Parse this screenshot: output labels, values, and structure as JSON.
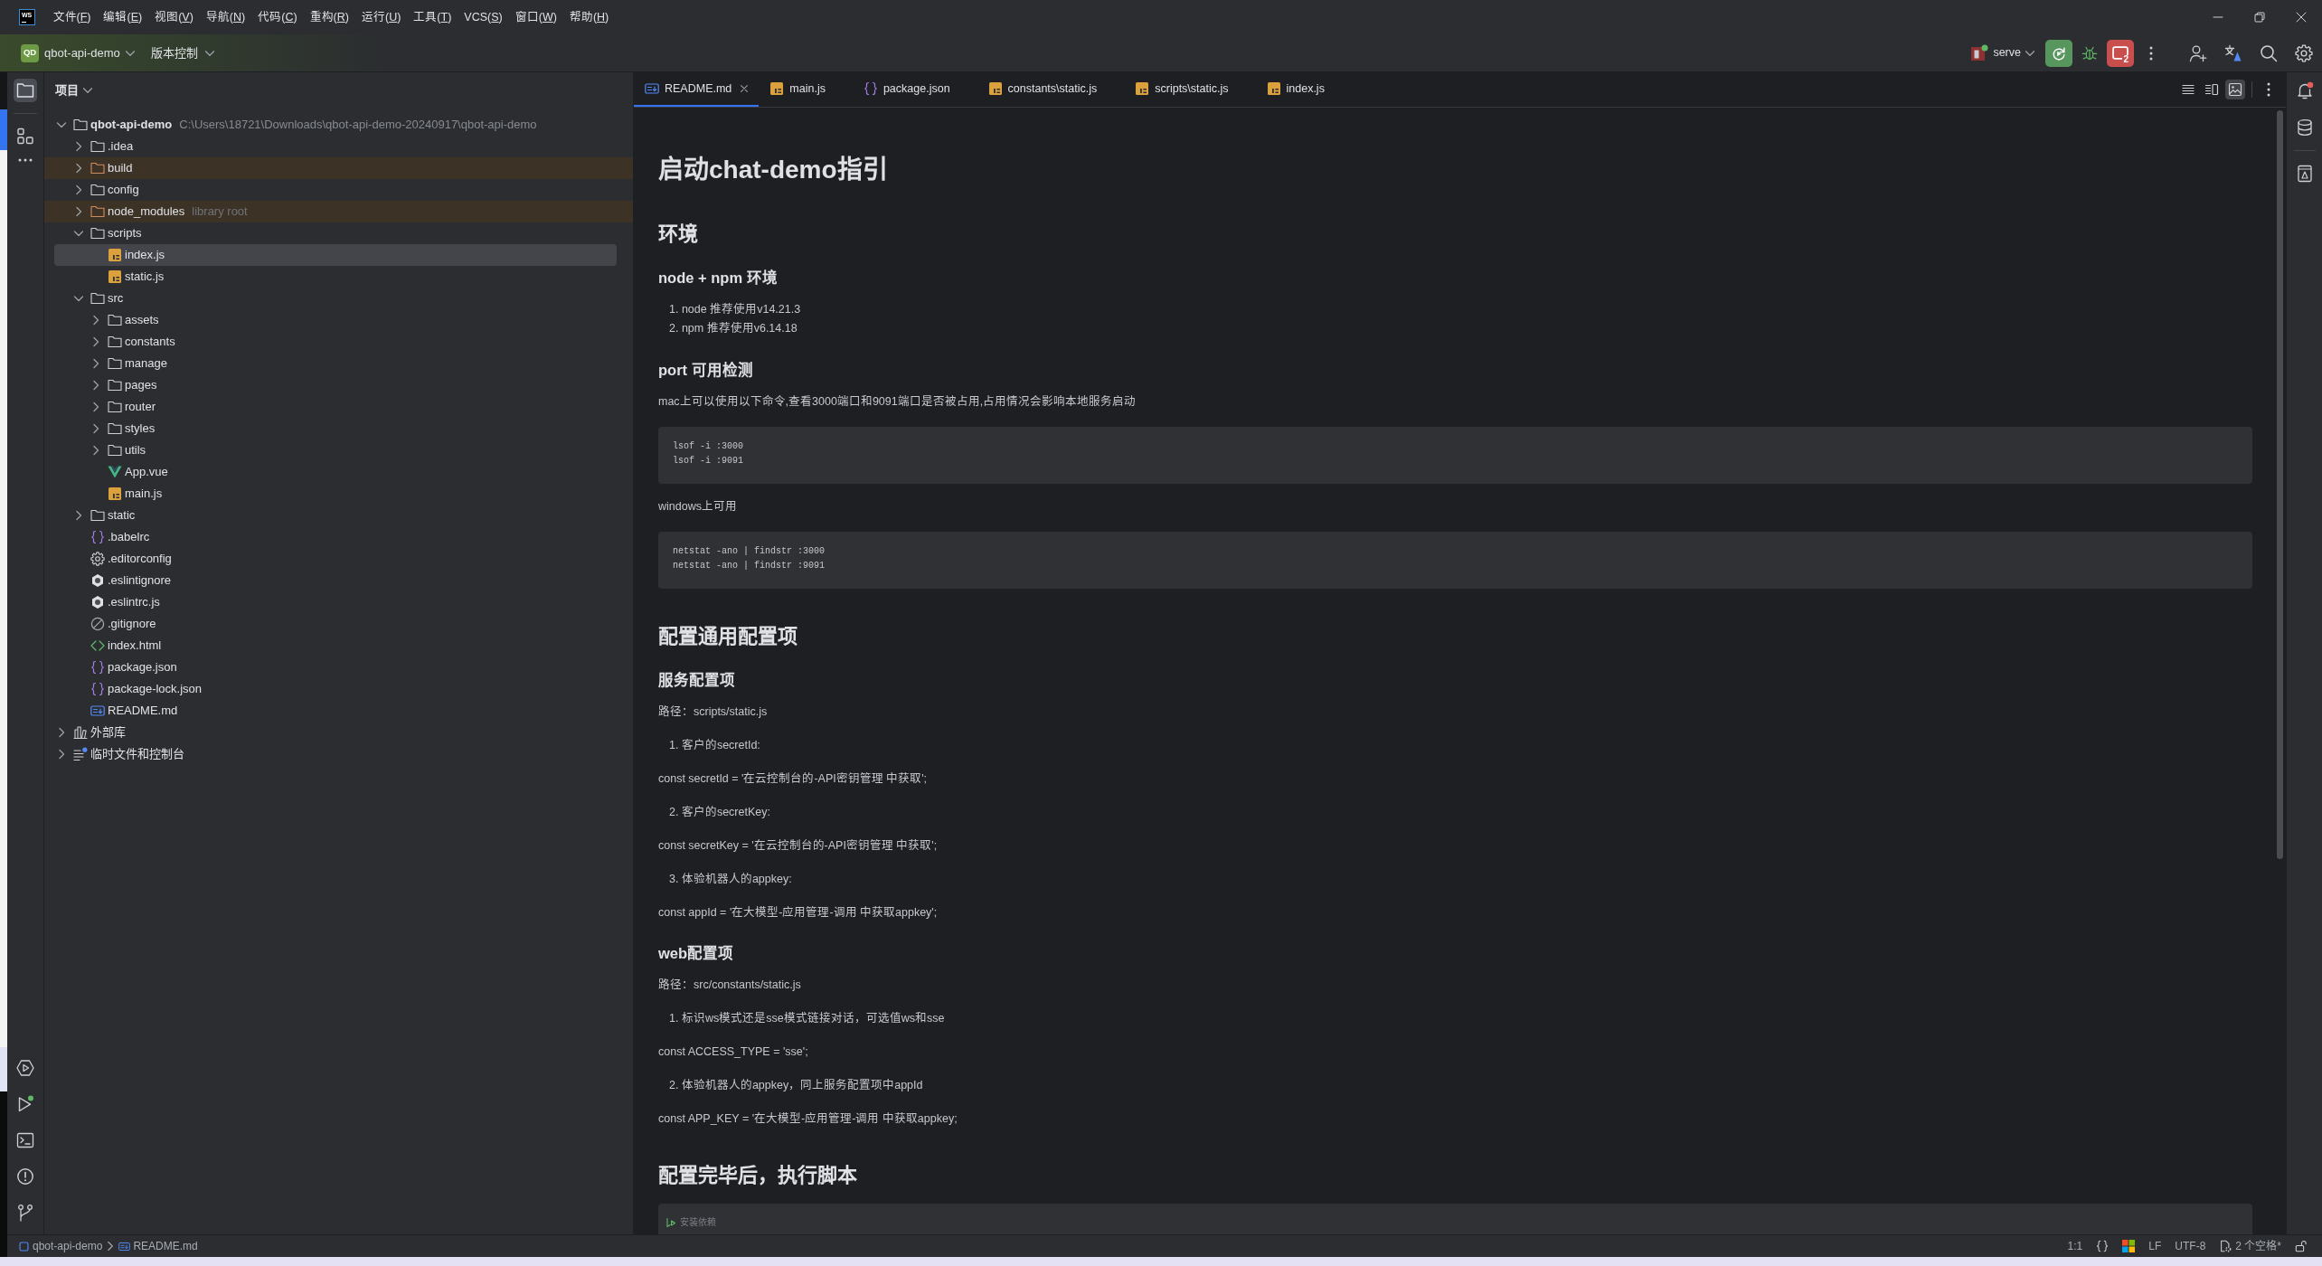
{
  "window": {
    "logo": "WS",
    "menu": [
      "文件(F)",
      "编辑(E)",
      "视图(V)",
      "导航(N)",
      "代码(C)",
      "重构(R)",
      "运行(U)",
      "工具(T)",
      "VCS(S)",
      "窗口(W)",
      "帮助(H)"
    ]
  },
  "toolbar": {
    "project_badge": "QD",
    "project": "qbot-api-demo",
    "vcs": "版本控制",
    "run_config": "serve",
    "stop_count": "2"
  },
  "tool_strip": [
    {
      "kind": "project",
      "selected": true
    },
    {
      "kind": "structure",
      "selected": false
    },
    {
      "kind": "more",
      "selected": false
    }
  ],
  "project_panel": {
    "title": "项目",
    "tree": [
      {
        "name": "qbot-api-demo",
        "path": "C:\\Users\\18721\\Downloads\\qbot-api-demo-20240917\\qbot-api-demo",
        "kind": "folder",
        "expanded": true,
        "excluded": false,
        "selected": false,
        "children": [
          {
            "name": ".idea",
            "kind": "folder",
            "expanded": false,
            "excluded": false,
            "selected": false
          },
          {
            "name": "build",
            "kind": "folder",
            "expanded": false,
            "excluded": true,
            "selected": false
          },
          {
            "name": "config",
            "kind": "folder",
            "expanded": false,
            "excluded": false,
            "selected": false
          },
          {
            "name": "node_modules",
            "note": "library root",
            "kind": "folder",
            "expanded": false,
            "excluded": true,
            "selected": false
          },
          {
            "name": "scripts",
            "kind": "folder",
            "expanded": true,
            "excluded": false,
            "selected": false,
            "children": [
              {
                "name": "index.js",
                "kind": "js",
                "selected": true
              },
              {
                "name": "static.js",
                "kind": "js",
                "selected": false
              }
            ]
          },
          {
            "name": "src",
            "kind": "folder",
            "expanded": true,
            "excluded": false,
            "selected": false,
            "children": [
              {
                "name": "assets",
                "kind": "folder",
                "expanded": false,
                "excluded": false,
                "selected": false
              },
              {
                "name": "constants",
                "kind": "folder",
                "expanded": false,
                "excluded": false,
                "selected": false
              },
              {
                "name": "manage",
                "kind": "folder",
                "expanded": false,
                "excluded": false,
                "selected": false
              },
              {
                "name": "pages",
                "kind": "folder",
                "expanded": false,
                "excluded": false,
                "selected": false
              },
              {
                "name": "router",
                "kind": "folder",
                "expanded": false,
                "excluded": false,
                "selected": false
              },
              {
                "name": "styles",
                "kind": "folder",
                "expanded": false,
                "excluded": false,
                "selected": false
              },
              {
                "name": "utils",
                "kind": "folder",
                "expanded": false,
                "excluded": false,
                "selected": false
              },
              {
                "name": "App.vue",
                "kind": "vue",
                "selected": false
              },
              {
                "name": "main.js",
                "kind": "js",
                "selected": false
              }
            ]
          },
          {
            "name": "static",
            "kind": "folder",
            "expanded": false,
            "excluded": false,
            "selected": false
          },
          {
            "name": ".babelrc",
            "kind": "json",
            "selected": false
          },
          {
            "name": ".editorconfig",
            "kind": "config",
            "selected": false
          },
          {
            "name": ".eslintignore",
            "kind": "eslint",
            "selected": false
          },
          {
            "name": ".eslintrc.js",
            "kind": "eslint",
            "selected": false
          },
          {
            "name": ".gitignore",
            "kind": "ignore",
            "selected": false
          },
          {
            "name": "index.html",
            "kind": "html",
            "selected": false
          },
          {
            "name": "package.json",
            "kind": "json",
            "selected": false
          },
          {
            "name": "package-lock.json",
            "kind": "json",
            "selected": false
          },
          {
            "name": "README.md",
            "kind": "markdown",
            "selected": false
          }
        ]
      },
      {
        "name": "外部库",
        "kind": "library",
        "expanded": false,
        "selected": false
      },
      {
        "name": "临时文件和控制台",
        "kind": "scratches",
        "expanded": false,
        "selected": false
      }
    ]
  },
  "editor": {
    "tabs": [
      {
        "label": "README.md",
        "kind": "markdown",
        "selected": true
      },
      {
        "label": "main.js",
        "kind": "js",
        "selected": false
      },
      {
        "label": "package.json",
        "kind": "json",
        "selected": false
      },
      {
        "label": "constants\\static.js",
        "kind": "js",
        "selected": false
      },
      {
        "label": "scripts\\static.js",
        "kind": "js",
        "selected": false
      },
      {
        "label": "index.js",
        "kind": "js",
        "selected": false
      }
    ],
    "view_modes": [
      {
        "kind": "editor",
        "selected": false
      },
      {
        "kind": "split",
        "selected": false
      },
      {
        "kind": "preview",
        "selected": true
      }
    ],
    "preview": [
      {
        "kind": "h1",
        "text": "启动chat-demo指引"
      },
      {
        "kind": "h2",
        "text": "环境"
      },
      {
        "kind": "h3",
        "text": "node + npm 环境"
      },
      {
        "kind": "ol",
        "items": [
          "1. node 推荐使用v14.21.3",
          "2. npm 推荐使用v6.14.18"
        ]
      },
      {
        "kind": "h3",
        "text": "port 可用检测"
      },
      {
        "kind": "p",
        "text": "mac上可以使用以下命令,查看3000端口和9091端口是否被占用,占用情况会影响本地服务启动"
      },
      {
        "kind": "code",
        "lines": [
          "lsof -i :3000",
          "lsof -i :9091"
        ]
      },
      {
        "kind": "p",
        "text": "windows上可用"
      },
      {
        "kind": "code",
        "lines": [
          "netstat -ano | findstr :3000",
          "netstat -ano | findstr :9091"
        ]
      },
      {
        "kind": "h2",
        "text": "配置通用配置项"
      },
      {
        "kind": "h3",
        "text": "服务配置项"
      },
      {
        "kind": "p",
        "text": "路径：scripts/static.js"
      },
      {
        "kind": "ol",
        "items": [
          "1. 客户的secretId:"
        ]
      },
      {
        "kind": "p",
        "text": "const secretId = '在云控制台的-API密钥管理 中获取';"
      },
      {
        "kind": "ol",
        "items": [
          "2. 客户的secretKey:"
        ]
      },
      {
        "kind": "p",
        "text": "const secretKey = '在云控制台的-API密钥管理 中获取';"
      },
      {
        "kind": "ol",
        "items": [
          "3. 体验机器人的appkey:"
        ]
      },
      {
        "kind": "p",
        "text": "const appId = '在大模型-应用管理-调用 中获取appkey';"
      },
      {
        "kind": "h3",
        "text": "web配置项"
      },
      {
        "kind": "p",
        "text": "路径：src/constants/static.js"
      },
      {
        "kind": "ol",
        "items": [
          "1. 标识ws模式还是sse模式链接对话，可选值ws和sse"
        ]
      },
      {
        "kind": "p",
        "text": "const ACCESS_TYPE = 'sse';"
      },
      {
        "kind": "ol",
        "items": [
          "2. 体验机器人的appkey，同上服务配置项中appId"
        ]
      },
      {
        "kind": "p",
        "text": "const APP_KEY = '在大模型-应用管理-调用 中获取appkey;"
      },
      {
        "kind": "h2",
        "text": "配置完毕后，执行脚本"
      },
      {
        "kind": "code",
        "runnable": true,
        "comment": true,
        "lines": [
          "安装依赖"
        ]
      }
    ]
  },
  "status_bar": {
    "breadcrumbs": [
      {
        "kind": "module",
        "label": "qbot-api-demo"
      },
      {
        "kind": "markdown",
        "label": "README.md"
      }
    ],
    "position": "1:1",
    "line_separator": "LF",
    "encoding": "UTF-8",
    "indent": "2 个空格*"
  }
}
